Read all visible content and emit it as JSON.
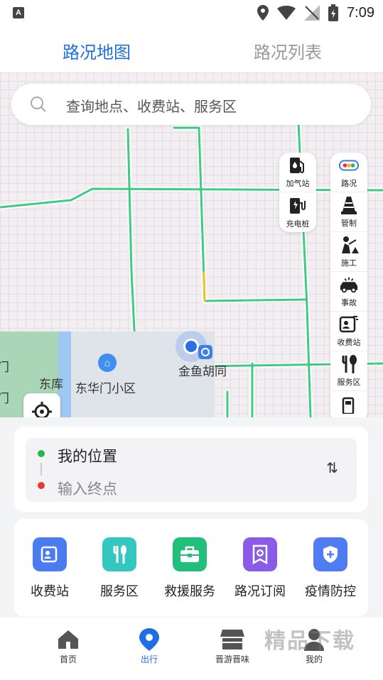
{
  "status_bar": {
    "time": "7:09",
    "left_icon": "A"
  },
  "tabs": {
    "active": "路况地图",
    "inactive": "路况列表"
  },
  "search": {
    "placeholder": "查询地点、收费站、服务区"
  },
  "map_labels": {
    "dongku": "东库",
    "donghuamen": "东华门小区",
    "jinyu": "金鱼胡同",
    "edge1": "门",
    "edge2": "门"
  },
  "fuel_panel": [
    {
      "label": "加气站",
      "icon": "gas-station-icon"
    },
    {
      "label": "充电桩",
      "icon": "charging-pile-icon"
    }
  ],
  "layer_panel": [
    {
      "label": "路况",
      "icon": "traffic-icon"
    },
    {
      "label": "管制",
      "icon": "cone-icon"
    },
    {
      "label": "施工",
      "icon": "construction-icon"
    },
    {
      "label": "事故",
      "icon": "accident-icon"
    },
    {
      "label": "收费站",
      "icon": "toll-icon"
    },
    {
      "label": "服务区",
      "icon": "service-area-icon"
    }
  ],
  "route": {
    "from": "我的位置",
    "to": "输入终点",
    "swap": "⇅"
  },
  "services": [
    {
      "label": "收费站",
      "icon": "toll-icon",
      "color": "#4a7cf0"
    },
    {
      "label": "服务区",
      "icon": "service-area-icon",
      "color": "#34c7c0"
    },
    {
      "label": "救援服务",
      "icon": "rescue-kit-icon",
      "color": "#21c07a"
    },
    {
      "label": "路况订阅",
      "icon": "subscribe-icon",
      "color": "#8a5ae8"
    },
    {
      "label": "疫情防控",
      "icon": "shield-icon",
      "color": "#4f7cf2"
    }
  ],
  "bottom_nav": [
    {
      "label": "首页",
      "icon": "home-icon"
    },
    {
      "label": "出行",
      "icon": "location-pin-icon",
      "active": true
    },
    {
      "label": "晋游晋味",
      "icon": "shop-icon"
    },
    {
      "label": "我的",
      "icon": "profile-icon"
    }
  ],
  "watermark": "精品下载",
  "colors": {
    "accent": "#1f6fe0",
    "road": "#3ecb82"
  }
}
